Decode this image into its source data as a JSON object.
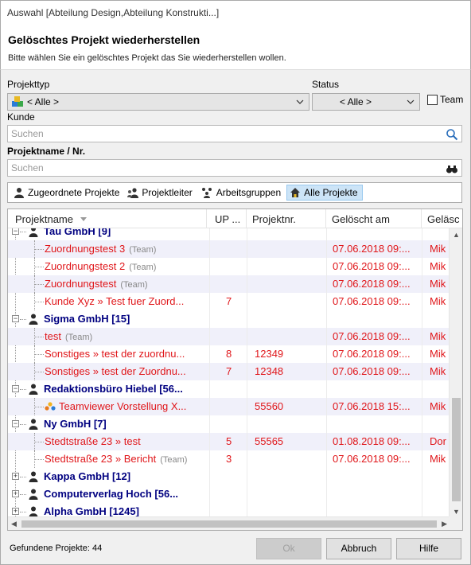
{
  "window": {
    "title": "Auswahl [Abteilung Design,Abteilung Konstrukti...]"
  },
  "header": {
    "title": "Gelöschtes Projekt wiederherstellen",
    "subtitle": "Bitte wählen Sie ein gelöschtes Projekt das Sie wiederherstellen wollen."
  },
  "filters": {
    "projekttyp_label": "Projekttyp",
    "projekttyp_value": "< Alle >",
    "status_label": "Status",
    "status_value": "< Alle >",
    "team_label": "Team",
    "kunde_label": "Kunde",
    "kunde_placeholder": "Suchen",
    "projektname_label": "Projektname / Nr.",
    "projektname_placeholder": "Suchen"
  },
  "tabs": [
    {
      "label": "Zugeordnete Projekte",
      "icon": "person-icon"
    },
    {
      "label": "Projektleiter",
      "icon": "manager-icon"
    },
    {
      "label": "Arbeitsgruppen",
      "icon": "group-icon"
    },
    {
      "label": "Alle Projekte",
      "icon": "home-icon"
    }
  ],
  "grid": {
    "columns": [
      "Projektname",
      "UP ...",
      "Projektnr.",
      "Gelöscht am",
      "Geläsc"
    ],
    "team_tag": "(Team)",
    "rows": [
      {
        "kind": "group",
        "name": "Tau GmbH [9]"
      },
      {
        "kind": "child",
        "name": "Zuordnungstest 3",
        "team": true,
        "up": "",
        "nr": "",
        "date": "07.06.2018 09:...",
        "by": "Mik"
      },
      {
        "kind": "child",
        "name": "Zuordnungstest 2",
        "team": true,
        "up": "",
        "nr": "",
        "date": "07.06.2018 09:...",
        "by": "Mik"
      },
      {
        "kind": "child",
        "name": "Zuordnungstest",
        "team": true,
        "up": "",
        "nr": "",
        "date": "07.06.2018 09:...",
        "by": "Mik"
      },
      {
        "kind": "child",
        "name": "Kunde Xyz » Test fuer Zuord...",
        "team": false,
        "up": "7",
        "nr": "",
        "date": "07.06.2018 09:...",
        "by": "Mik"
      },
      {
        "kind": "group",
        "name": "Sigma GmbH [15]"
      },
      {
        "kind": "child",
        "name": "test",
        "team": true,
        "up": "",
        "nr": "",
        "date": "07.06.2018 09:...",
        "by": "Mik"
      },
      {
        "kind": "child",
        "name": "Sonstiges » test der zuordnu...",
        "team": false,
        "up": "8",
        "nr": "12349",
        "date": "07.06.2018 09:...",
        "by": "Mik"
      },
      {
        "kind": "child",
        "name": "Sonstiges » test der Zuordnu...",
        "team": false,
        "up": "7",
        "nr": "12348",
        "date": "07.06.2018 09:...",
        "by": "Mik"
      },
      {
        "kind": "group",
        "name": "Redaktionsbüro Hiebel [56..."
      },
      {
        "kind": "child",
        "name": "Teamviewer Vorstellung X...",
        "team": false,
        "up": "",
        "nr": "55560",
        "date": "07.06.2018 15:...",
        "by": "Mik",
        "icon": true
      },
      {
        "kind": "group",
        "name": "Ny GmbH [7]"
      },
      {
        "kind": "child",
        "name": "Stedtstraße 23 » test",
        "team": false,
        "up": "5",
        "nr": "55565",
        "date": "01.08.2018 09:...",
        "by": "Dor"
      },
      {
        "kind": "child",
        "name": "Stedtstraße 23 » Bericht",
        "team": true,
        "up": "3",
        "nr": "",
        "date": "07.06.2018 09:...",
        "by": "Mik"
      },
      {
        "kind": "group-collapsed",
        "name": "Kappa GmbH [12]"
      },
      {
        "kind": "group-collapsed",
        "name": "Computerverlag Hoch [56..."
      },
      {
        "kind": "group-collapsed",
        "name": "Alpha GmbH [1245]"
      }
    ]
  },
  "footer": {
    "count_text": "Gefundene Projekte: 44",
    "ok_label": "Ok",
    "cancel_label": "Abbruch",
    "help_label": "Hilfe"
  }
}
